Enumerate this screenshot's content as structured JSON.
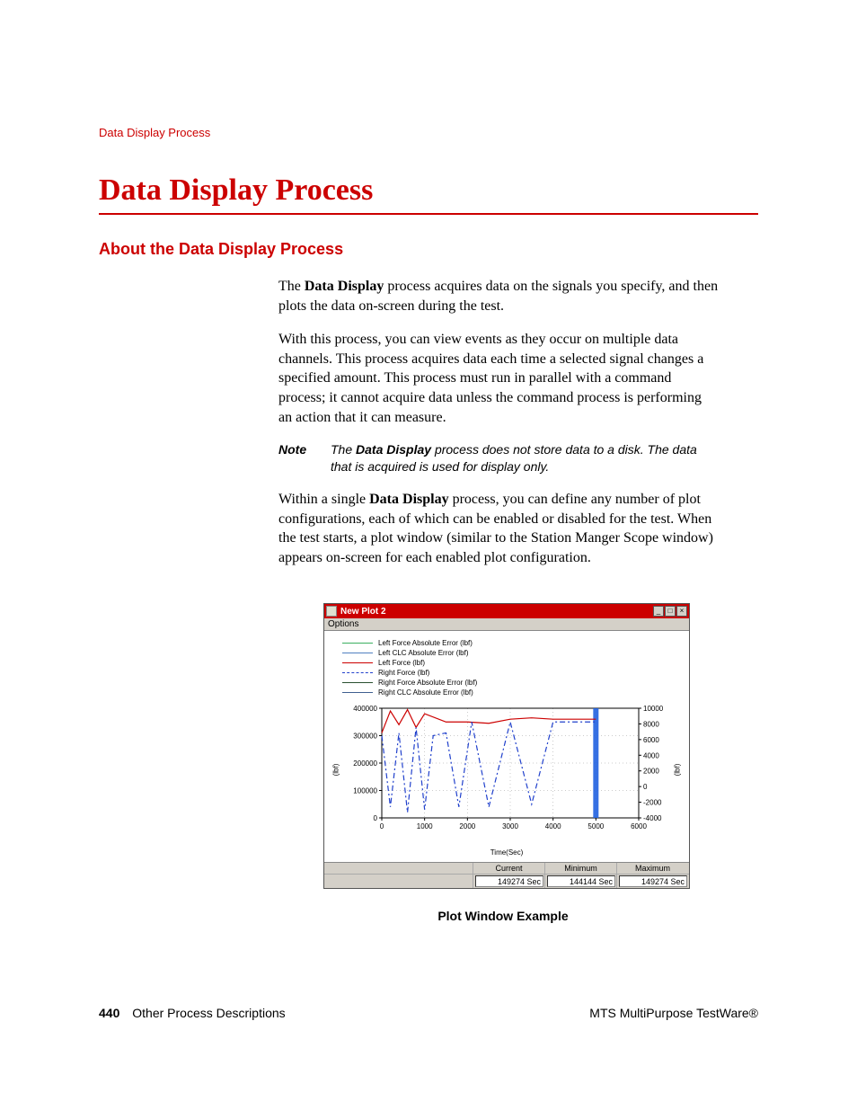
{
  "breadcrumb": "Data Display Process",
  "title": "Data Display Process",
  "subtitle": "About the Data Display Process",
  "paragraphs": {
    "p1_a": "The ",
    "p1_b": "Data Display",
    "p1_c": " process acquires data on the signals you specify, and then plots the data on-screen during the test.",
    "p2": "With this process, you can view events as they occur on multiple data channels. This process acquires data each time a selected signal changes a specified amount. This process must run in parallel with a command process; it cannot acquire data unless the command process is performing an action that it can measure.",
    "p3_a": "Within a single ",
    "p3_b": "Data Display",
    "p3_c": " process, you can define any number of plot configurations, each of which can be enabled or disabled for the test. When the test starts, a plot window (similar to the Station Manger Scope window) appears on-screen for each enabled plot configuration."
  },
  "note": {
    "label": "Note",
    "text_a": "The ",
    "text_b": "Data Display",
    "text_c": " process does not store data to a disk. The data that is acquired is used for display only."
  },
  "plot": {
    "window_title": "New Plot 2",
    "menu": "Options",
    "legend": [
      {
        "label": "Left Force Absolute Error (lbf)",
        "color": "#3bb060",
        "dash": false
      },
      {
        "label": "Left CLC Absolute Error (lbf)",
        "color": "#5080c0",
        "dash": false
      },
      {
        "label": "Left Force (lbf)",
        "color": "#cc0000",
        "dash": false
      },
      {
        "label": "Right Force (lbf)",
        "color": "#2040cc",
        "dash": true
      },
      {
        "label": "Right Force Absolute Error (lbf)",
        "color": "#2a5030",
        "dash": false
      },
      {
        "label": "Right CLC Absolute Error (lbf)",
        "color": "#406090",
        "dash": false
      }
    ],
    "xlabel": "Time(Sec)",
    "ylabel_left": "(lbf)",
    "ylabel_right": "(lbf)",
    "stats": {
      "headers": [
        "Current",
        "Minimum",
        "Maximum"
      ],
      "values": [
        "149274 Sec",
        "144144 Sec",
        "149274 Sec"
      ]
    }
  },
  "chart_data": {
    "type": "line",
    "title": "New Plot 2",
    "xlabel": "Time(Sec)",
    "ylabel": "(lbf)",
    "x_ticks": [
      0,
      1000,
      2000,
      3000,
      4000,
      5000,
      6000
    ],
    "y_left_ticks": [
      0,
      100000,
      200000,
      300000,
      400000
    ],
    "y_right_ticks": [
      -4000,
      -2000,
      0,
      2000,
      4000,
      6000,
      8000,
      10000
    ],
    "xlim": [
      0,
      6000
    ],
    "ylim_left": [
      0,
      400000
    ],
    "ylim_right": [
      -4000,
      10000
    ],
    "series": [
      {
        "name": "Left Force (lbf)",
        "axis": "left",
        "color": "#cc0000",
        "x": [
          0,
          200,
          400,
          600,
          800,
          1000,
          1500,
          2000,
          2500,
          3000,
          3500,
          4000,
          4500,
          5000
        ],
        "values": [
          310000,
          390000,
          340000,
          395000,
          330000,
          380000,
          350000,
          350000,
          345000,
          360000,
          365000,
          360000,
          360000,
          360000
        ]
      },
      {
        "name": "Right Force (lbf)",
        "axis": "left",
        "color": "#2040cc",
        "dash": true,
        "x": [
          0,
          200,
          400,
          600,
          800,
          1000,
          1200,
          1500,
          1800,
          2100,
          2500,
          3000,
          3500,
          4000,
          4500,
          5000
        ],
        "values": [
          300000,
          40000,
          310000,
          20000,
          330000,
          30000,
          300000,
          310000,
          40000,
          350000,
          40000,
          350000,
          50000,
          350000,
          350000,
          350000
        ]
      }
    ],
    "highlight_bar": {
      "x": 5000,
      "color": "#2060e0"
    }
  },
  "caption": "Plot Window Example",
  "footer": {
    "page": "440",
    "section": "Other Process Descriptions",
    "product": "MTS MultiPurpose TestWare®"
  }
}
